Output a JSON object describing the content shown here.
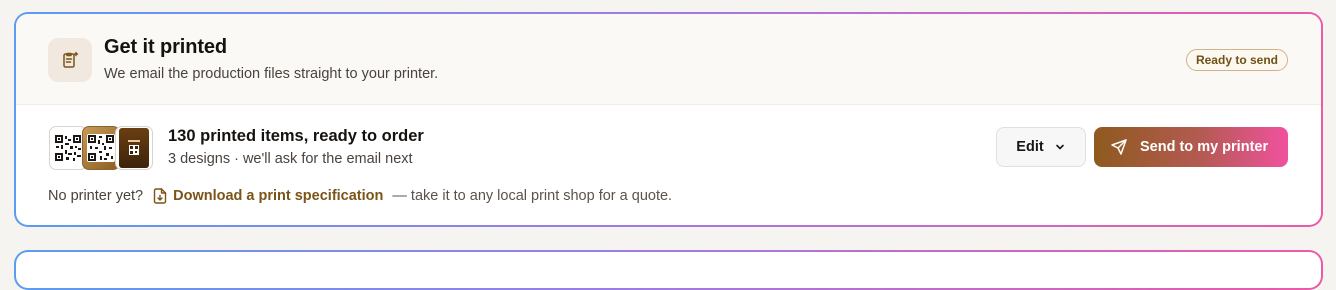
{
  "header": {
    "icon": "clipboard-print-icon",
    "title": "Get it printed",
    "subtitle": "We email the production files straight to your printer.",
    "badge": "Ready to send"
  },
  "order": {
    "thumbnails": [
      "qr-code-thumbnail",
      "qr-code-gold-thumbnail",
      "poster-thumbnail"
    ],
    "title": "130 printed items, ready to order",
    "subtitle": "3 designs · we'll ask for the email next",
    "edit_label": "Edit",
    "send_label": "Send to my printer"
  },
  "footer": {
    "prefix": "No printer yet?",
    "link_label": "Download a print specification",
    "suffix": "— take it to any local print shop for a quote."
  },
  "colors": {
    "accent": "#7a5418",
    "badge_text": "#6e5119",
    "gradient_start": "#5b9cf0",
    "gradient_end": "#ec5aa8",
    "button_start": "#8e5a1e",
    "button_end": "#f0529e"
  }
}
